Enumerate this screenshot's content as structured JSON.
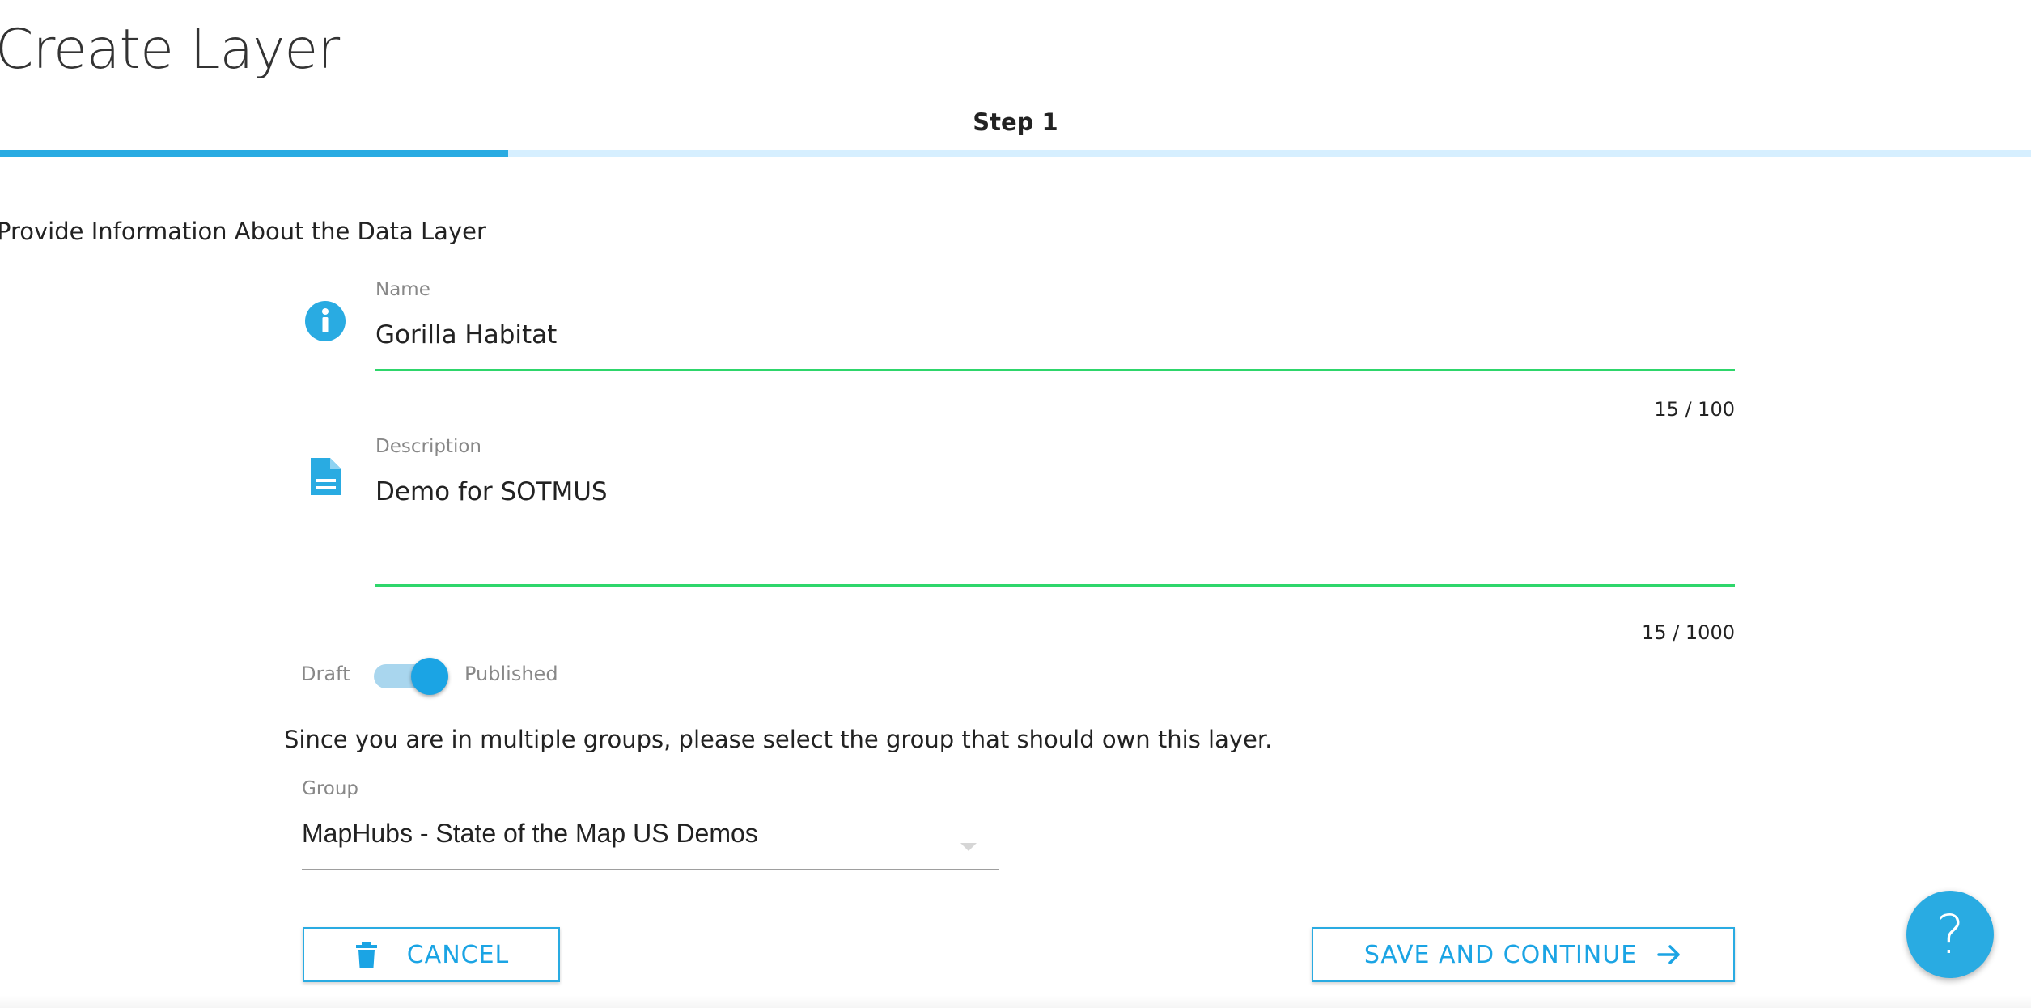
{
  "page": {
    "title": "Create Layer",
    "step_label": "Step 1",
    "progress_fraction": 0.25
  },
  "form": {
    "heading": "Provide Information About the Data Layer",
    "name": {
      "label": "Name",
      "value": "Gorilla Habitat",
      "counter": "15 / 100",
      "icon": "info-icon"
    },
    "description": {
      "label": "Description",
      "value": "Demo for SOTMUS",
      "counter": "15 / 1000",
      "icon": "document-icon"
    },
    "publish_toggle": {
      "off_label": "Draft",
      "on_label": "Published",
      "checked": true
    },
    "group": {
      "intro": "Since you are in multiple groups, please select the group that should own this layer.",
      "label": "Group",
      "selected": "MapHubs - State of the Map US Demos"
    }
  },
  "actions": {
    "cancel_label": "CANCEL",
    "cancel_icon": "trash-icon",
    "save_label": "SAVE AND CONTINUE",
    "save_icon": "arrow-right-icon"
  },
  "help": {
    "glyph": "?"
  },
  "colors": {
    "accent": "#29abe2",
    "valid_underline": "#2ed66b",
    "progress_track": "#d6efff"
  }
}
